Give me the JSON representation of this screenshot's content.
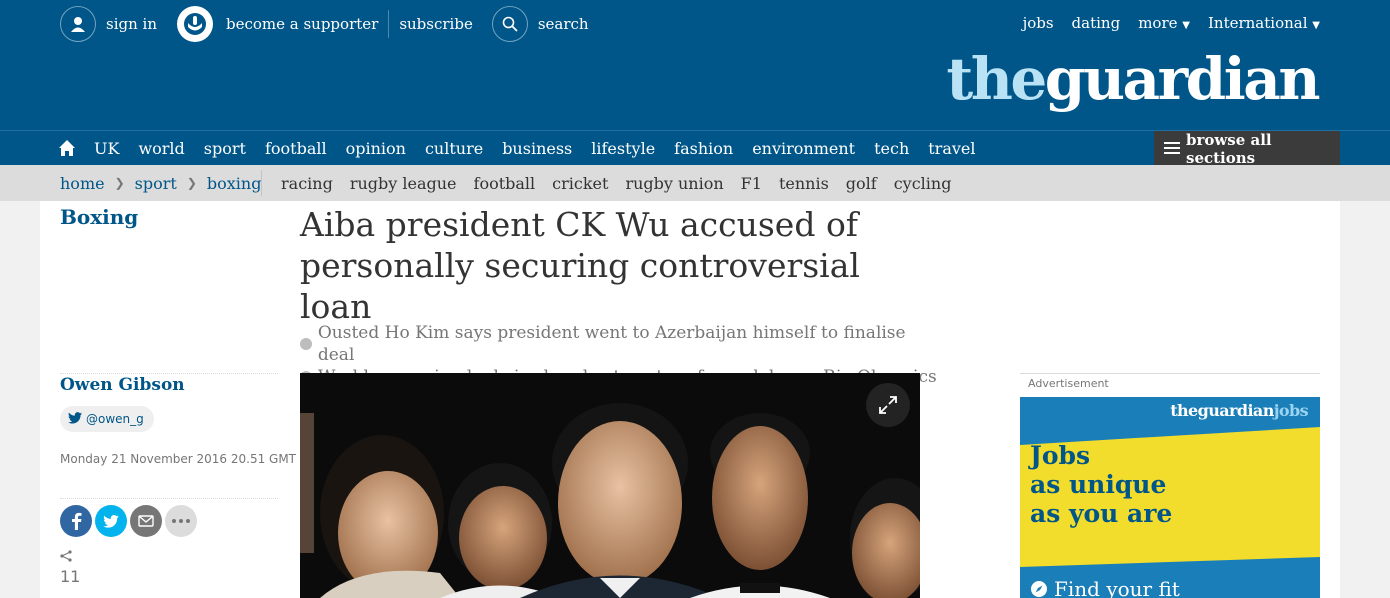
{
  "header": {
    "sign_in": "sign in",
    "supporter": "become a supporter",
    "subscribe": "subscribe",
    "search": "search",
    "right_links": [
      "jobs",
      "dating",
      "more",
      "International"
    ],
    "logo_the": "the",
    "logo_guardian": "guardian"
  },
  "nav": {
    "items": [
      "UK",
      "world",
      "sport",
      "football",
      "opinion",
      "culture",
      "business",
      "lifestyle",
      "fashion",
      "environment",
      "tech",
      "travel"
    ],
    "browse": "browse all sections"
  },
  "subnav": {
    "breadcrumbs": [
      "home",
      "sport",
      "boxing"
    ],
    "sports": [
      "racing",
      "rugby league",
      "football",
      "cricket",
      "rugby union",
      "F1",
      "tennis",
      "golf",
      "cycling"
    ]
  },
  "article": {
    "section": "Boxing",
    "headline": "Aiba president CK Wu accused of personally securing controversial loan",
    "standfirst": [
      "Ousted Ho Kim says president went to Azerbaijan himself to finalise deal",
      "World governing body is already at centre of scandal over Rio Olympics"
    ],
    "author": "Owen Gibson",
    "twitter": "@owen_g",
    "date": "Monday 21 November 2016 20.51 GMT",
    "share_count": "11"
  },
  "ad": {
    "label": "Advertisement",
    "brand_the": "theguardian",
    "brand_jobs": "jobs",
    "slogan": [
      "Jobs",
      "as unique",
      "as you are"
    ],
    "cta": "Find your fit"
  },
  "colors": {
    "brand_blue": "#005689",
    "ad_yellow": "#f2dc2c"
  }
}
